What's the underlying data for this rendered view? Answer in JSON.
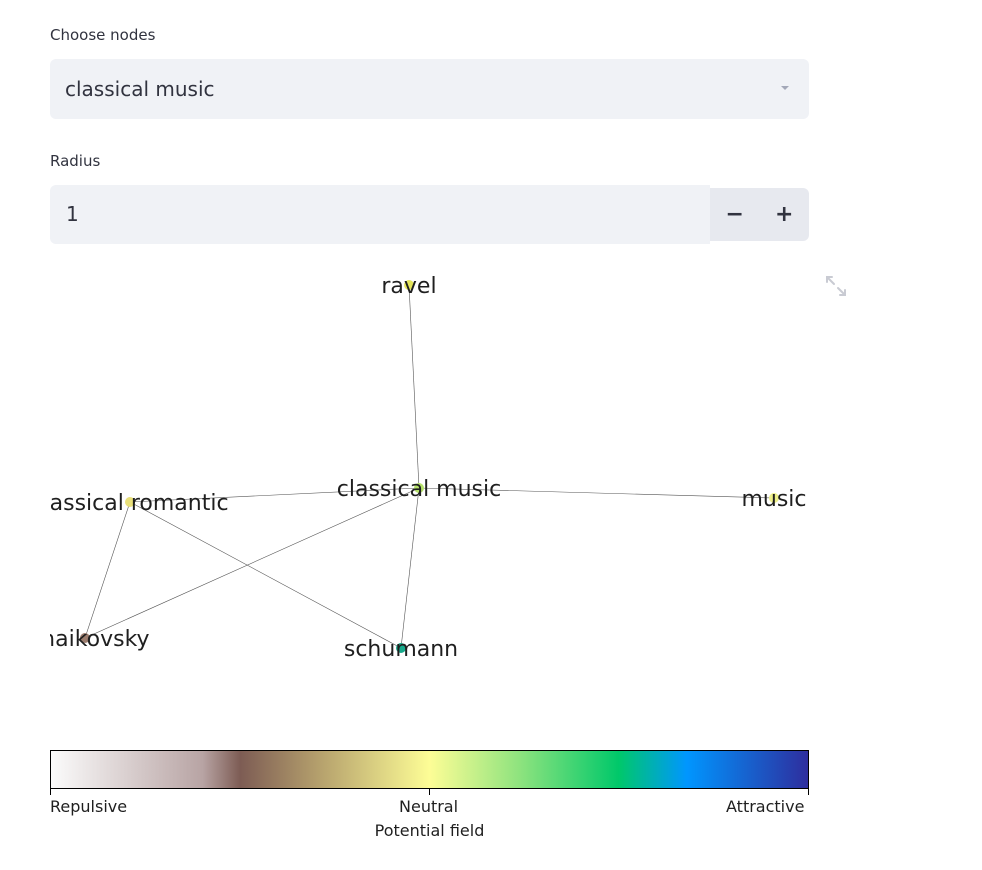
{
  "controls": {
    "nodes_label": "Choose nodes",
    "nodes_value": "classical music",
    "radius_label": "Radius",
    "radius_value": "1",
    "decrement_label": "−",
    "increment_label": "+"
  },
  "graph": {
    "nodes": [
      {
        "id": "ravel",
        "label": "ravel",
        "color": "#e6e65a"
      },
      {
        "id": "classical-music",
        "label": "classical music",
        "color": "#b6e26a"
      },
      {
        "id": "classical-romantic",
        "label": "classical romantic",
        "color": "#e9e07a"
      },
      {
        "id": "music",
        "label": "music",
        "color": "#eef08a"
      },
      {
        "id": "tchaikovsky",
        "label": "tchaikovsky",
        "color": "#9c7d6e"
      },
      {
        "id": "schumann",
        "label": "schumann",
        "color": "#17a98b"
      }
    ],
    "edges": [
      [
        "ravel",
        "classical-music"
      ],
      [
        "classical-music",
        "classical-romantic"
      ],
      [
        "classical-music",
        "music"
      ],
      [
        "classical-music",
        "tchaikovsky"
      ],
      [
        "classical-music",
        "schumann"
      ],
      [
        "classical-romantic",
        "tchaikovsky"
      ],
      [
        "classical-romantic",
        "schumann"
      ]
    ]
  },
  "colorbar": {
    "left_label": "Repulsive",
    "center_label": "Neutral",
    "right_label": "Attractive",
    "title": "Potential field"
  },
  "icons": {
    "expand": "expand-icon",
    "dropdown": "chevron-down-icon"
  }
}
